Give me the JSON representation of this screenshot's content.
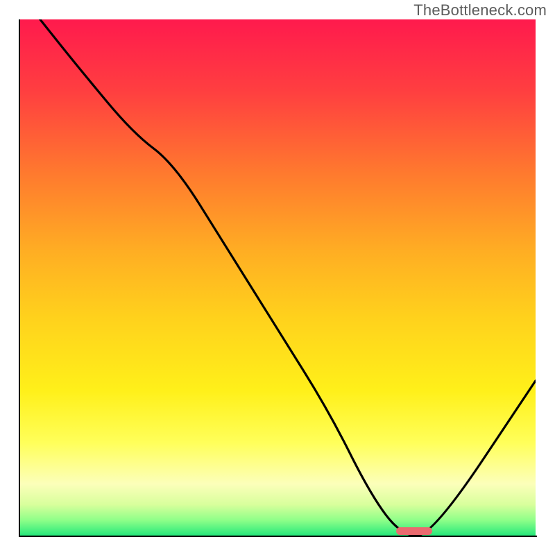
{
  "watermark": "TheBottleneck.com",
  "chart_data": {
    "type": "line",
    "title": "",
    "xlabel": "",
    "ylabel": "",
    "xlim": [
      0,
      100
    ],
    "ylim": [
      0,
      100
    ],
    "grid": false,
    "legend": false,
    "series": [
      {
        "name": "bottleneck-curve",
        "x": [
          4,
          12,
          22,
          30,
          40,
          50,
          60,
          68,
          74,
          80,
          100
        ],
        "values": [
          100,
          90,
          78,
          72,
          56,
          40,
          24,
          8,
          0,
          0,
          30
        ]
      }
    ],
    "marker": {
      "name": "optimal-range",
      "x_start": 73,
      "x_end": 80,
      "y": 0,
      "color": "#ea6a6f"
    },
    "background_gradient": {
      "top": "#ff1a4d",
      "bottom": "#26e87b"
    }
  }
}
